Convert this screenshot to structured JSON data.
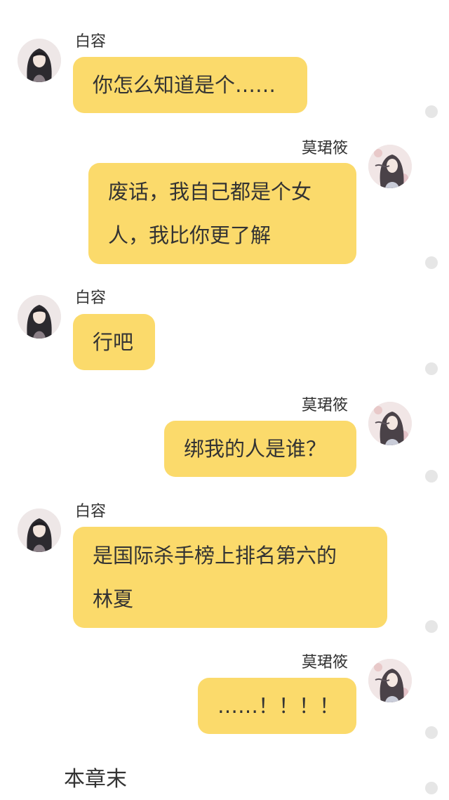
{
  "participants": {
    "left": {
      "name": "白容",
      "avatar_icon": "long-hair-character-avatar-icon"
    },
    "right": {
      "name": "莫珺筱",
      "avatar_icon": "flowing-hair-girl-avatar-icon"
    }
  },
  "messages": [
    {
      "side": "left",
      "sender": "白容",
      "lines": [
        "你怎么知道是个……"
      ]
    },
    {
      "side": "right",
      "sender": "莫珺筱",
      "lines": [
        "废话，我自己都是个女",
        "人，我比你更了解"
      ]
    },
    {
      "side": "left",
      "sender": "白容",
      "lines": [
        "行吧"
      ]
    },
    {
      "side": "right",
      "sender": "莫珺筱",
      "lines": [
        "绑我的人是谁？"
      ]
    },
    {
      "side": "left",
      "sender": "白容",
      "lines": [
        "是国际杀手榜上排名第六的",
        "林夏"
      ]
    },
    {
      "side": "right",
      "sender": "莫珺筱",
      "lines": [
        "……！！！！"
      ]
    }
  ],
  "footer": {
    "end_text": "本章末"
  },
  "colors": {
    "bubble": "#fbda6b",
    "dot": "#e6e6e6",
    "text": "#333333"
  }
}
